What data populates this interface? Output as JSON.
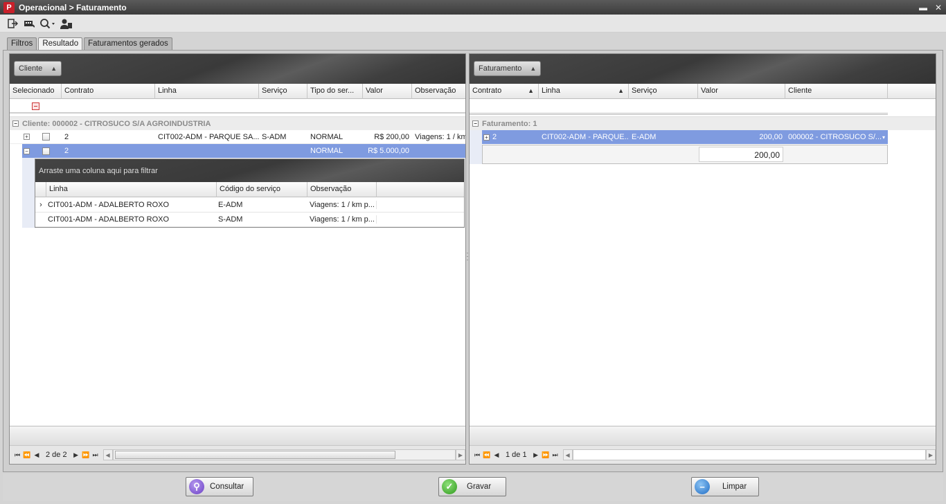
{
  "window": {
    "title": "Operacional > Faturamento",
    "logo_letter": "P",
    "minimize_label": "▬",
    "close_label": "✕"
  },
  "toolbar": {
    "icons": [
      "exit-icon",
      "keyboard-icon",
      "search-icon",
      "user-icon"
    ]
  },
  "tabs": [
    {
      "label": "Filtros",
      "active": false
    },
    {
      "label": "Resultado",
      "active": true
    },
    {
      "label": "Faturamentos gerados",
      "active": false
    }
  ],
  "left_grid": {
    "group_chip": "Cliente",
    "columns": [
      "Selecionado",
      "Contrato",
      "Linha",
      "Serviço",
      "Tipo do ser...",
      "Valor",
      "Observação"
    ],
    "group_row": "Cliente: 000002 - CITROSUCO S/A AGROINDUSTRIA",
    "rows": [
      {
        "contrato": "2",
        "linha": "CIT002-ADM - PARQUE SA...",
        "servico": "S-ADM",
        "tipo": "NORMAL",
        "valor": "R$ 200,00",
        "observacao": "Viagens: 1 / km"
      },
      {
        "contrato": "2",
        "linha": "",
        "servico": "",
        "tipo": "NORMAL",
        "valor": "R$ 5.000,00",
        "observacao": ""
      }
    ],
    "detail": {
      "drag_hint": "Arraste uma coluna aqui para filtrar",
      "columns": [
        "Linha",
        "Código do serviço",
        "Observação"
      ],
      "rows": [
        {
          "linha": "CIT001-ADM - ADALBERTO ROXO",
          "codigo": "E-ADM",
          "observacao": "Viagens: 1 / km p..."
        },
        {
          "linha": "CIT001-ADM - ADALBERTO ROXO",
          "codigo": "S-ADM",
          "observacao": "Viagens: 1 / km p..."
        }
      ]
    },
    "pager": "2 de 2"
  },
  "right_grid": {
    "group_chip": "Faturamento",
    "columns": [
      "Contrato",
      "Linha",
      "Serviço",
      "Valor",
      "Cliente"
    ],
    "group_row": "Faturamento: 1",
    "rows": [
      {
        "contrato": "2",
        "linha": "CIT002-ADM - PARQUE...",
        "servico": "E-ADM",
        "valor": "200,00",
        "cliente": "000002 - CITROSUCO S/..."
      }
    ],
    "summary_value": "200,00",
    "pager": "1 de 1"
  },
  "buttons": {
    "consultar": "Consultar",
    "gravar": "Gravar",
    "limpar": "Limpar"
  },
  "colors": {
    "selection": "#7f9be0",
    "accent_red": "#c8202a"
  }
}
